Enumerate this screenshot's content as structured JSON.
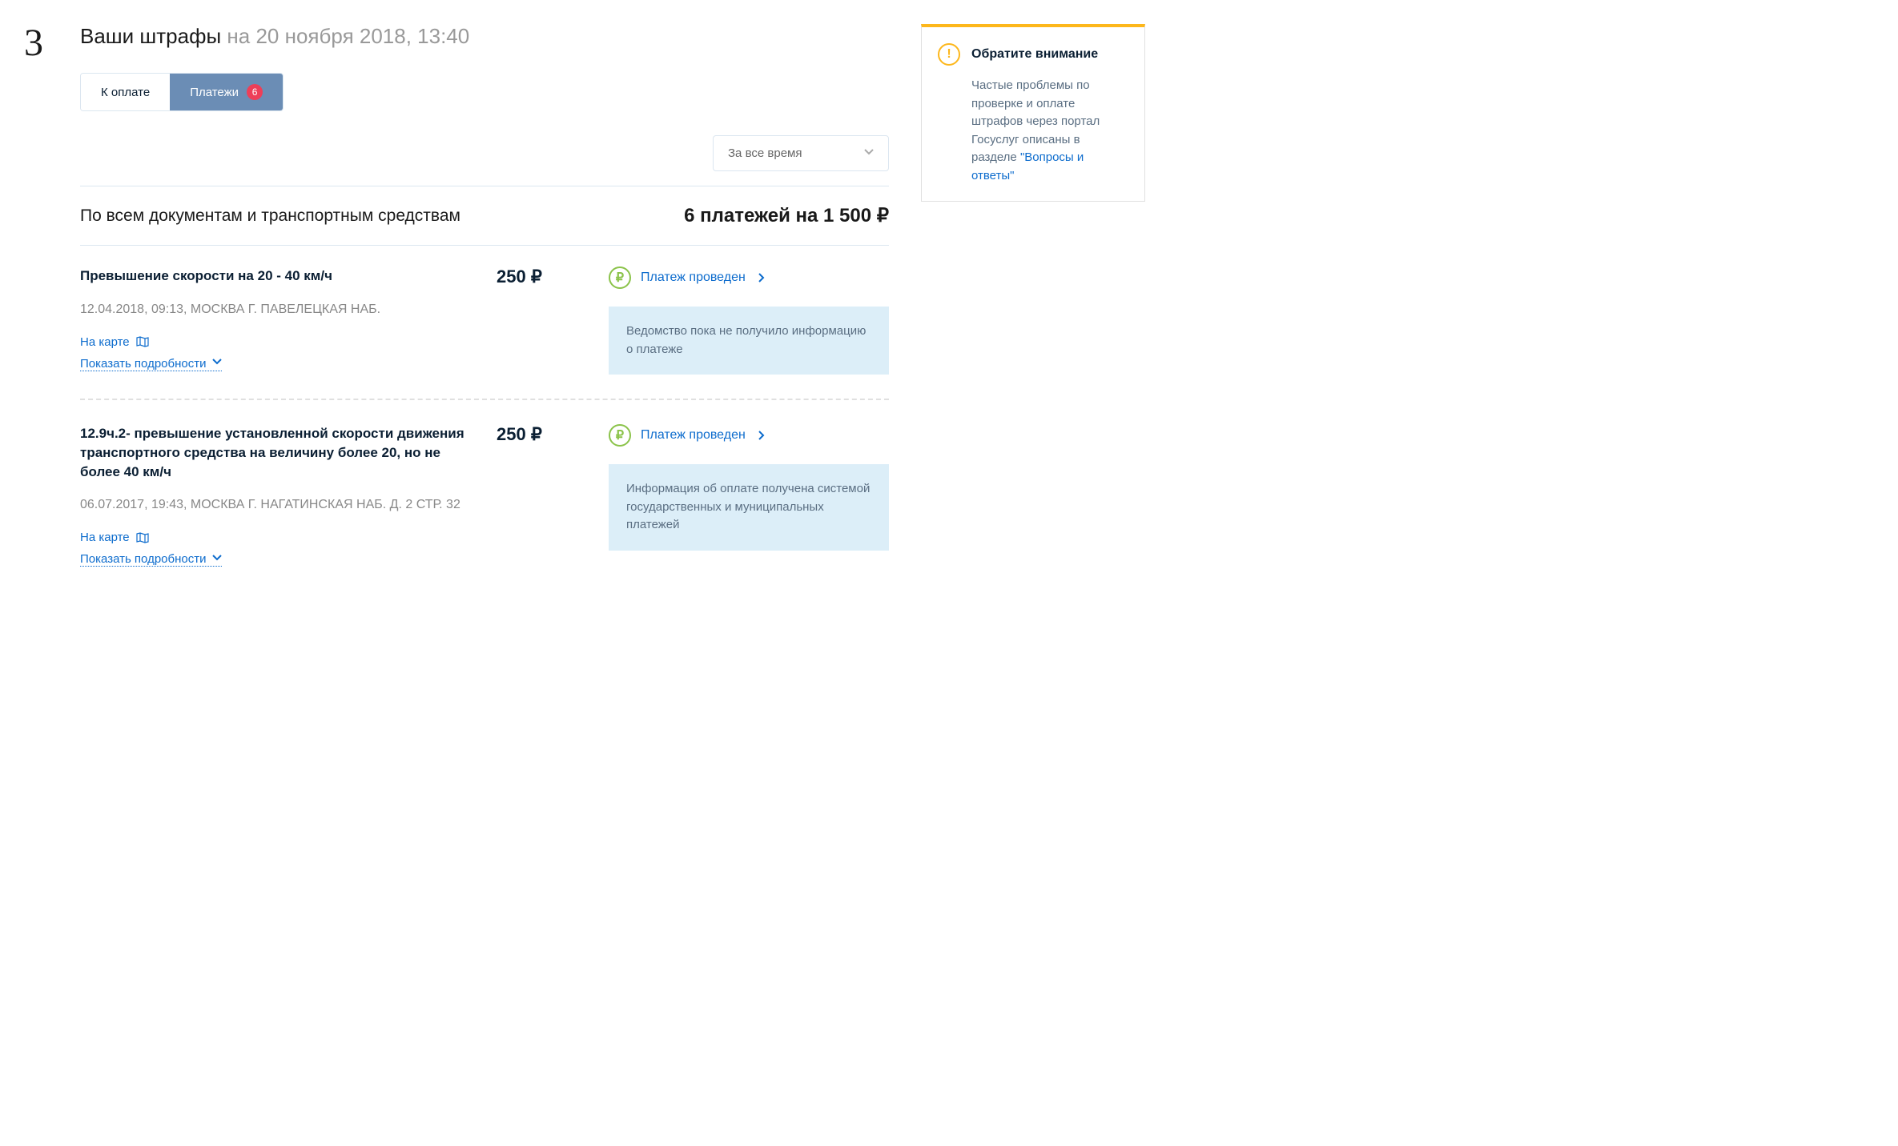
{
  "step": "3",
  "header": {
    "title": "Ваши штрафы",
    "timestamp": "на 20 ноября 2018, 13:40"
  },
  "tabs": {
    "to_pay": "К оплате",
    "payments": "Платежи",
    "badge": "6"
  },
  "filter": {
    "selected": "За все время"
  },
  "summary": {
    "left": "По всем документам и транспортным средствам",
    "right_count": "6 платежей на",
    "right_amount": "1 500 ₽"
  },
  "fines": [
    {
      "title": "Превышение скорости на 20 - 40 км/ч",
      "meta": "12.04.2018, 09:13, МОСКВА Г. ПАВЕЛЕЦКАЯ НАБ.",
      "map_link": "На карте",
      "details_link": "Показать подробности",
      "amount": "250 ₽",
      "status": "Платеж проведен",
      "info": "Ведомство пока не получило информацию о платеже"
    },
    {
      "title": "12.9ч.2- превышение установленной скорости движения транспортного средства на величину более 20, но не более 40 км/ч",
      "meta": "06.07.2017, 19:43, МОСКВА Г. НАГАТИНСКАЯ НАБ. Д. 2 СТР. 32",
      "map_link": "На карте",
      "details_link": "Показать подробности",
      "amount": "250 ₽",
      "status": "Платеж проведен",
      "info": "Информация об оплате получена системой государственных и муниципальных платежей"
    }
  ],
  "notice": {
    "title": "Обратите внимание",
    "text": "Частые проблемы по проверке и оплате штрафов через портал Госуслуг описаны в разделе ",
    "link": "\"Вопросы и ответы\""
  }
}
